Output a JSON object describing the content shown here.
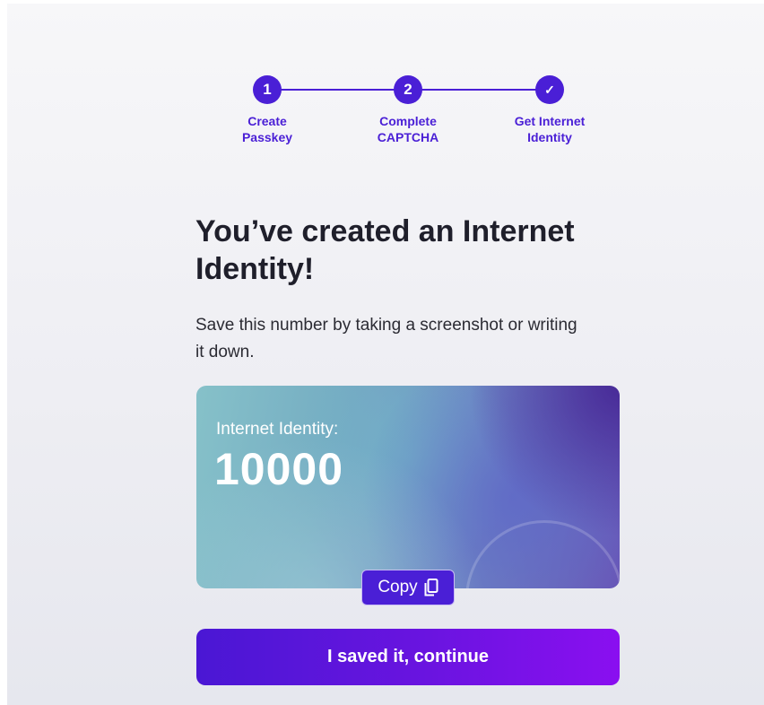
{
  "stepper": {
    "steps": [
      {
        "marker": "1",
        "label": "Create\nPasskey"
      },
      {
        "marker": "2",
        "label": "Complete\nCAPTCHA"
      },
      {
        "marker": "✓",
        "label": "Get Internet\nIdentity"
      }
    ]
  },
  "heading": "You’ve created an Internet Identity!",
  "subtext": "Save this number by taking a screenshot or writing it down.",
  "card": {
    "label": "Internet Identity:",
    "number": "10000"
  },
  "copy_button": {
    "label": "Copy",
    "icon": "copy-icon"
  },
  "continue_button": {
    "label": "I saved it, continue"
  },
  "colors": {
    "accent": "#4a1fd6",
    "button_gradient_start": "#4a17d4",
    "button_gradient_end": "#8a0ff0",
    "heading_text": "#1f1f2b"
  }
}
